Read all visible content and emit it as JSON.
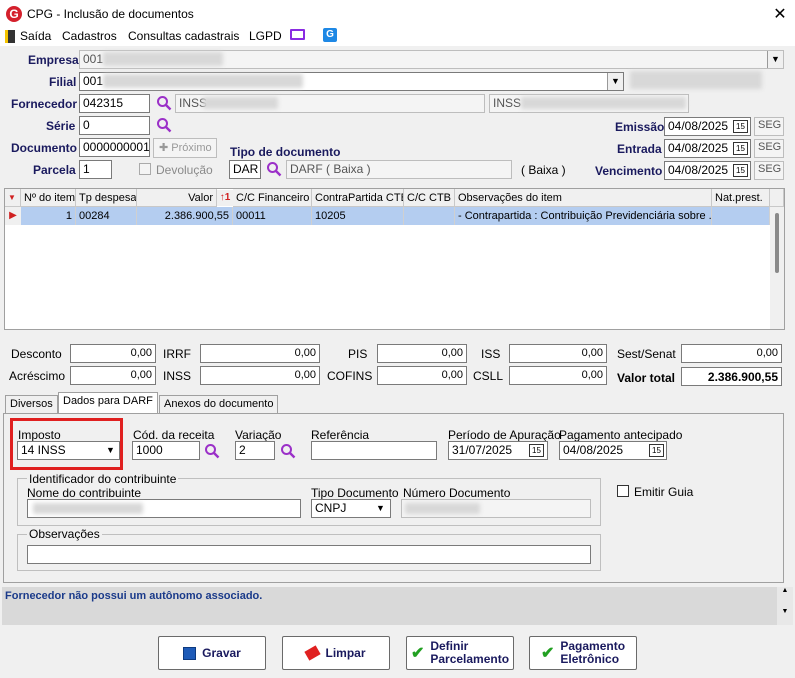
{
  "window": {
    "title": "CPG - Inclusão de documentos",
    "close_glyph": "✕",
    "app_icon_letter": "G"
  },
  "menu": {
    "items": [
      "Saída",
      "Cadastros",
      "Consultas cadastrais",
      "LGPD"
    ]
  },
  "form": {
    "empresa_label": "Empresa",
    "empresa_value": "001",
    "filial_label": "Filial",
    "filial_value": "001",
    "fornecedor_label": "Fornecedor",
    "fornecedor_value": "042315",
    "fornecedor_name": "INSS",
    "fornecedor_name2": "INSS",
    "serie_label": "Série",
    "serie_value": "0",
    "documento_label": "Documento",
    "documento_value": "0000000001",
    "proximo_label": "Próximo",
    "parcela_label": "Parcela",
    "parcela_value": "1",
    "devolucao_label": "Devolução",
    "tipo_doc_label": "Tipo de documento",
    "tipo_doc_code": "DAR",
    "tipo_doc_desc": "DARF ( Baixa )",
    "tipo_doc_baixa": "( Baixa )",
    "emissao_label": "Emissão",
    "emissao_value": "04/08/2025",
    "emissao_day": "SEG",
    "entrada_label": "Entrada",
    "entrada_value": "04/08/2025",
    "entrada_day": "SEG",
    "vencimento_label": "Vencimento",
    "vencimento_value": "04/08/2025",
    "vencimento_day": "SEG"
  },
  "grid": {
    "headers": [
      "Nº do item",
      "Tp despesa",
      "Valor",
      "C/C Financeiro",
      "ContraPartida CTB",
      "C/C CTB",
      "Observações do item",
      "Nat.prest."
    ],
    "sort_indicator": "1",
    "rows": [
      [
        "1",
        "00284",
        "2.386.900,55",
        "00011",
        "10205",
        "",
        "- Contrapartida : Contribuição Previdenciária sobre ...",
        ""
      ]
    ]
  },
  "totals": {
    "desconto_label": "Desconto",
    "desconto": "0,00",
    "acrescimo_label": "Acréscimo",
    "acrescimo": "0,00",
    "irrf_label": "IRRF",
    "irrf": "0,00",
    "inss_label": "INSS",
    "inss": "0,00",
    "pis_label": "PIS",
    "pis": "0,00",
    "cofins_label": "COFINS",
    "cofins": "0,00",
    "iss_label": "ISS",
    "iss": "0,00",
    "csll_label": "CSLL",
    "csll": "0,00",
    "sest_label": "Sest/Senat",
    "sest": "0,00",
    "valor_total_label": "Valor total",
    "valor_total": "2.386.900,55"
  },
  "tabs": [
    "Diversos",
    "Dados para DARF",
    "Anexos do documento"
  ],
  "darf": {
    "imposto_label": "Imposto",
    "imposto_value": "14 INSS",
    "cod_receita_label": "Cód. da receita",
    "cod_receita_value": "1000",
    "variacao_label": "Variação",
    "variacao_value": "2",
    "referencia_label": "Referência",
    "referencia_value": "",
    "periodo_label": "Período de Apuração",
    "periodo_value": "31/07/2025",
    "pagamento_label": "Pagamento antecipado",
    "pagamento_value": "04/08/2025",
    "identificador_label": "Identificador do contribuinte",
    "nome_label": "Nome do contribuinte",
    "tipo_documento_label": "Tipo Documento",
    "tipo_documento_value": "CNPJ",
    "numero_documento_label": "Número Documento",
    "emitir_guia_label": "Emitir Guia",
    "observacoes_label": "Observações"
  },
  "status": {
    "message": "Fornecedor não possui um autônomo associado."
  },
  "buttons": {
    "gravar": "Gravar",
    "limpar": "Limpar",
    "definir_1": "Definir",
    "definir_2": "Parcelamento",
    "pagamento_1": "Pagamento",
    "pagamento_2": "Eletrônico"
  },
  "colors": {
    "accent": "#1a1a5e",
    "selection": "#b4cdf0",
    "highlight": "#e02020",
    "status_text": "#1a3a8a"
  }
}
